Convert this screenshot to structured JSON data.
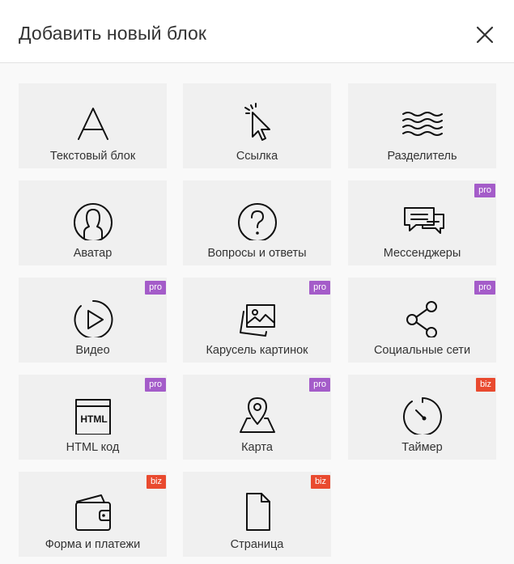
{
  "dialog": {
    "title": "Добавить новый блок",
    "close_icon": "close-icon"
  },
  "colors": {
    "pro": "#a45cc9",
    "biz": "#e94a2f",
    "tile": "#f0f0f0"
  },
  "blocks": [
    {
      "label": "Текстовый блок",
      "icon": "text-icon",
      "badge": ""
    },
    {
      "label": "Ссылка",
      "icon": "cursor-click-icon",
      "badge": ""
    },
    {
      "label": "Разделитель",
      "icon": "waves-icon",
      "badge": ""
    },
    {
      "label": "Аватар",
      "icon": "avatar-icon",
      "badge": ""
    },
    {
      "label": "Вопросы и ответы",
      "icon": "question-icon",
      "badge": ""
    },
    {
      "label": "Мессенджеры",
      "icon": "chat-bubbles-icon",
      "badge": "pro"
    },
    {
      "label": "Видео",
      "icon": "play-icon",
      "badge": "pro"
    },
    {
      "label": "Карусель картинок",
      "icon": "images-icon",
      "badge": "pro"
    },
    {
      "label": "Социальные сети",
      "icon": "share-icon",
      "badge": "pro"
    },
    {
      "label": "HTML код",
      "icon": "html-icon",
      "badge": "pro",
      "icon_text": "HTML"
    },
    {
      "label": "Карта",
      "icon": "map-pin-icon",
      "badge": "pro"
    },
    {
      "label": "Таймер",
      "icon": "timer-icon",
      "badge": "biz"
    },
    {
      "label": "Форма и платежи",
      "icon": "wallet-icon",
      "badge": "biz"
    },
    {
      "label": "Страница",
      "icon": "page-icon",
      "badge": "biz"
    }
  ]
}
